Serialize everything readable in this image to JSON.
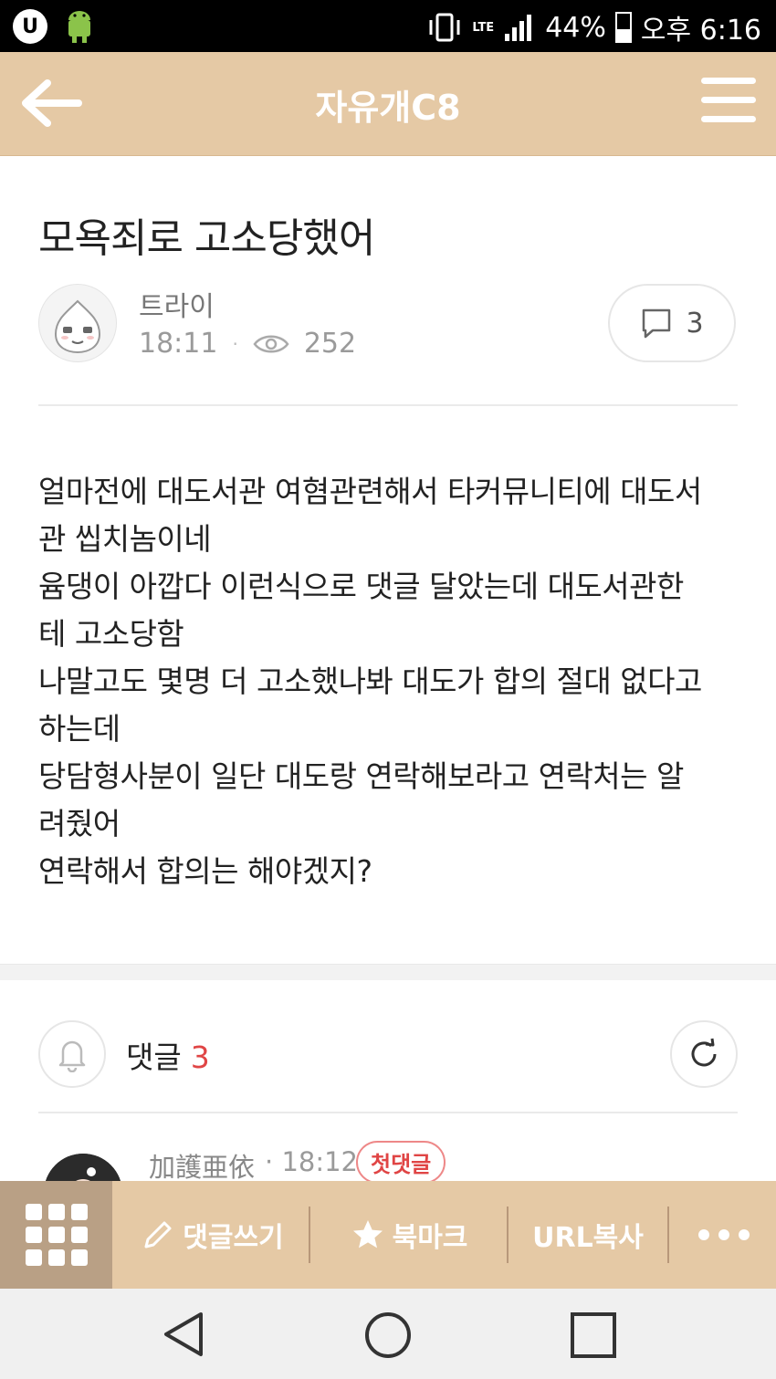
{
  "status_bar": {
    "battery": "44%",
    "battery_level": 0.44,
    "time": "오후 6:16",
    "network": "LTE"
  },
  "app_bar": {
    "title": "자유개C8"
  },
  "post": {
    "title": "모욕죄로 고소당했어",
    "author": "트라이",
    "time": "18:11",
    "views": "252",
    "comment_count": "3",
    "body": "얼마전에 대도서관 여혐관련해서 타커뮤니티에 대도서\n관 씹치놈이네\n윰댕이 아깝다 이런식으로 댓글 달았는데 대도서관한\n테 고소당함\n나말고도 몇명 더 고소했나봐 대도가 합의 절대 없다고\n하는데\n당담형사분이 일단 대도랑 연락해보라고 연락처는 알\n려줬어\n연락해서 합의는 해야겠지?"
  },
  "comments": {
    "label": "댓글",
    "count": "3",
    "first": {
      "author": "加護亜依",
      "time": "18:12",
      "badge": "첫댓글"
    }
  },
  "bottom_bar": {
    "write_label": "댓글쓰기",
    "bookmark_label": "북마크",
    "copy_url_label": "URL복사"
  },
  "colors": {
    "accent": "#e5c9a5",
    "accent_dark": "#b9a085",
    "highlight": "#e04545"
  }
}
